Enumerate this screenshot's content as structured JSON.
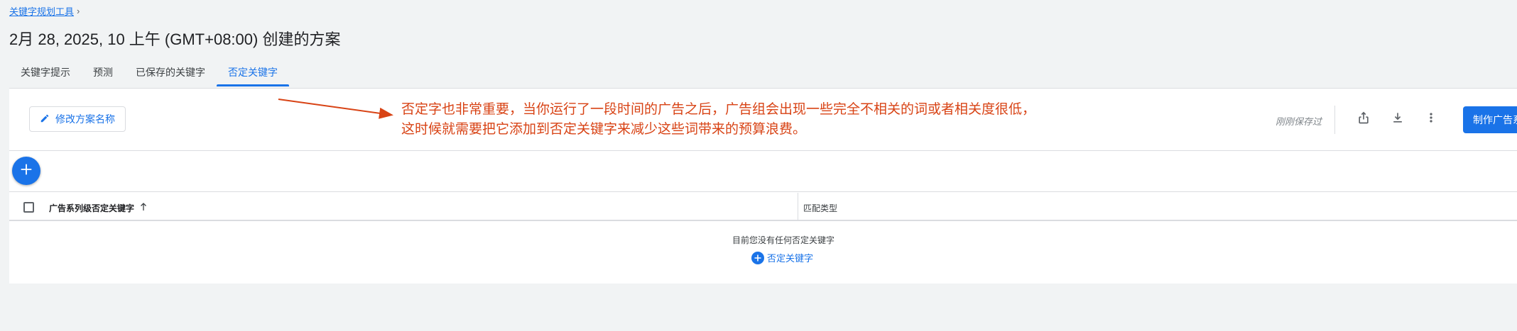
{
  "breadcrumb": {
    "label": "关键字规划工具",
    "chevron_icon": "chevron-right-icon"
  },
  "page": {
    "title": "2月 28, 2025, 10 上午 (GMT+08:00) 创建的方案"
  },
  "tabs": [
    {
      "label": "关键字提示",
      "active": false
    },
    {
      "label": "预测",
      "active": false
    },
    {
      "label": "已保存的关键字",
      "active": false
    },
    {
      "label": "否定关键字",
      "active": true
    }
  ],
  "toolbar": {
    "rename_label": "修改方案名称",
    "rename_icon": "pencil-icon",
    "saved_status": "刚刚保存过",
    "share_icon": "share-icon",
    "download_icon": "download-icon",
    "more_icon": "more-vert-icon",
    "create_label": "制作广告系"
  },
  "annotation": {
    "line1": "否定字也非常重要，当你运行了一段时间的广告之后，广告组会出现一些完全不相关的词或者相关度很低，",
    "line2": "这时候就需要把它添加到否定关键字来减少这些词带来的预算浪费。",
    "color": "#d84315"
  },
  "table": {
    "columns": [
      {
        "label": "广告系列级否定关键字",
        "sort": "ascending"
      },
      {
        "label": "匹配类型"
      }
    ],
    "empty_message": "目前您没有任何否定关键字",
    "empty_add_label": "否定关键字"
  },
  "colors": {
    "accent": "#1a73e8",
    "background": "#f1f3f4",
    "annotation": "#d84315"
  }
}
